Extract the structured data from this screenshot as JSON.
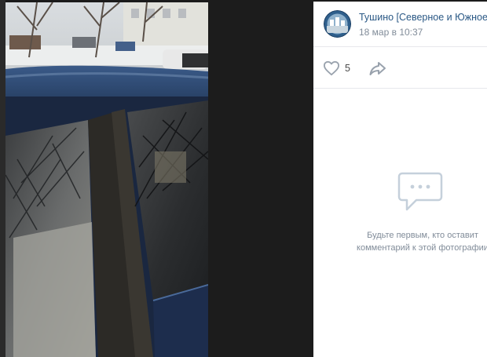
{
  "post": {
    "author": "Тушино [Северное и Южное]",
    "date": "18 мар в 10:37",
    "likes": "5"
  },
  "comments": {
    "empty_line1": "Будьте первым, кто оставит",
    "empty_line2": "комментарий к этой фотографии"
  },
  "icons": {
    "like": "heart-icon",
    "share": "share-arrow-icon",
    "comments": "speech-bubble-icon"
  },
  "colors": {
    "link": "#2a5885",
    "muted": "#818c99",
    "viewer_bg": "#1c1c1c"
  }
}
